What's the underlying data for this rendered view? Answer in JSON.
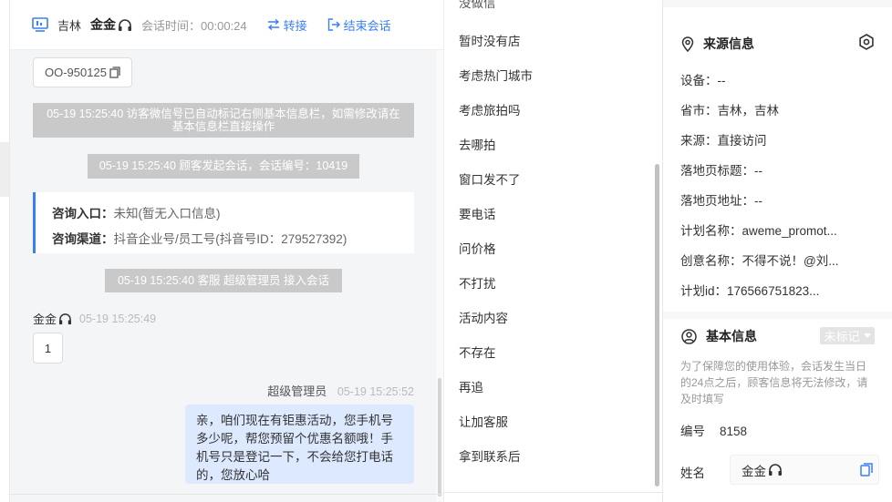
{
  "header": {
    "location": "吉林",
    "agent_name": "金金",
    "session_time_label": "会话时间：",
    "session_time_value": "00:00:24",
    "transfer_label": "转接",
    "end_label": "结束会话"
  },
  "chat": {
    "order_code": "OO-950125",
    "system_messages": [
      "05-19 15:25:40 访客微信号已自动标记右侧基本信息栏，如需修改请在基本信息栏直接操作",
      "05-19 15:25:40 顾客发起会话，会话编号：10419",
      "05-19 15:25:40 客服 超级管理员 接入会话"
    ],
    "entry": {
      "entry_label": "咨询入口：",
      "entry_value": "未知(暂无入口信息)",
      "channel_label": "咨询渠道：",
      "channel_value": "抖音企业号/员工号(抖音号ID：279527392)"
    },
    "agent_msg": {
      "sender": "金金",
      "time": "05-19 15:25:49",
      "text": "1"
    },
    "admin_msg": {
      "sender": "超级管理员",
      "time": "05-19 15:25:52",
      "text": "亲，咱们现在有钜惠活动，您手机号多少呢，帮您预留个优惠名额哦！手机号只是登记一下，不会给您打电话的，您放心哈"
    }
  },
  "quick_replies": {
    "top_partial": "没做信",
    "items": [
      "暂时没有店",
      "考虑热门城市",
      "考虑旅拍吗",
      "去哪拍",
      "窗口发不了",
      "要电话",
      "问价格",
      "不打扰",
      "活动内容",
      "不存在",
      "再追",
      "让加客服",
      "拿到联系后"
    ]
  },
  "source_info": {
    "title": "来源信息",
    "fields": [
      {
        "label": "设备：",
        "value": "--"
      },
      {
        "label": "省市：",
        "value": "吉林，吉林"
      },
      {
        "label": "来源：",
        "value": "直接访问"
      },
      {
        "label": "落地页标题：",
        "value": "--"
      },
      {
        "label": "落地页地址：",
        "value": "--"
      },
      {
        "label": "计划名称：",
        "value": "aweme_promot..."
      },
      {
        "label": "创意名称：",
        "value": "不得不说！@刘..."
      },
      {
        "label": "计划id：",
        "value": "176566751823..."
      }
    ]
  },
  "basic_info": {
    "title": "基本信息",
    "tag_select": "未标记",
    "notice": "为了保障您的使用体验，会话发生当日的24点之后，顾客信息将无法修改，请及时填写",
    "number_label": "编号",
    "number_value": "8158",
    "name_label": "姓名",
    "name_value": "金金"
  },
  "colors": {
    "accent": "#3a7ff5",
    "system_bubble": "#c9c9c9",
    "outgoing_bubble": "#dde9fe"
  }
}
